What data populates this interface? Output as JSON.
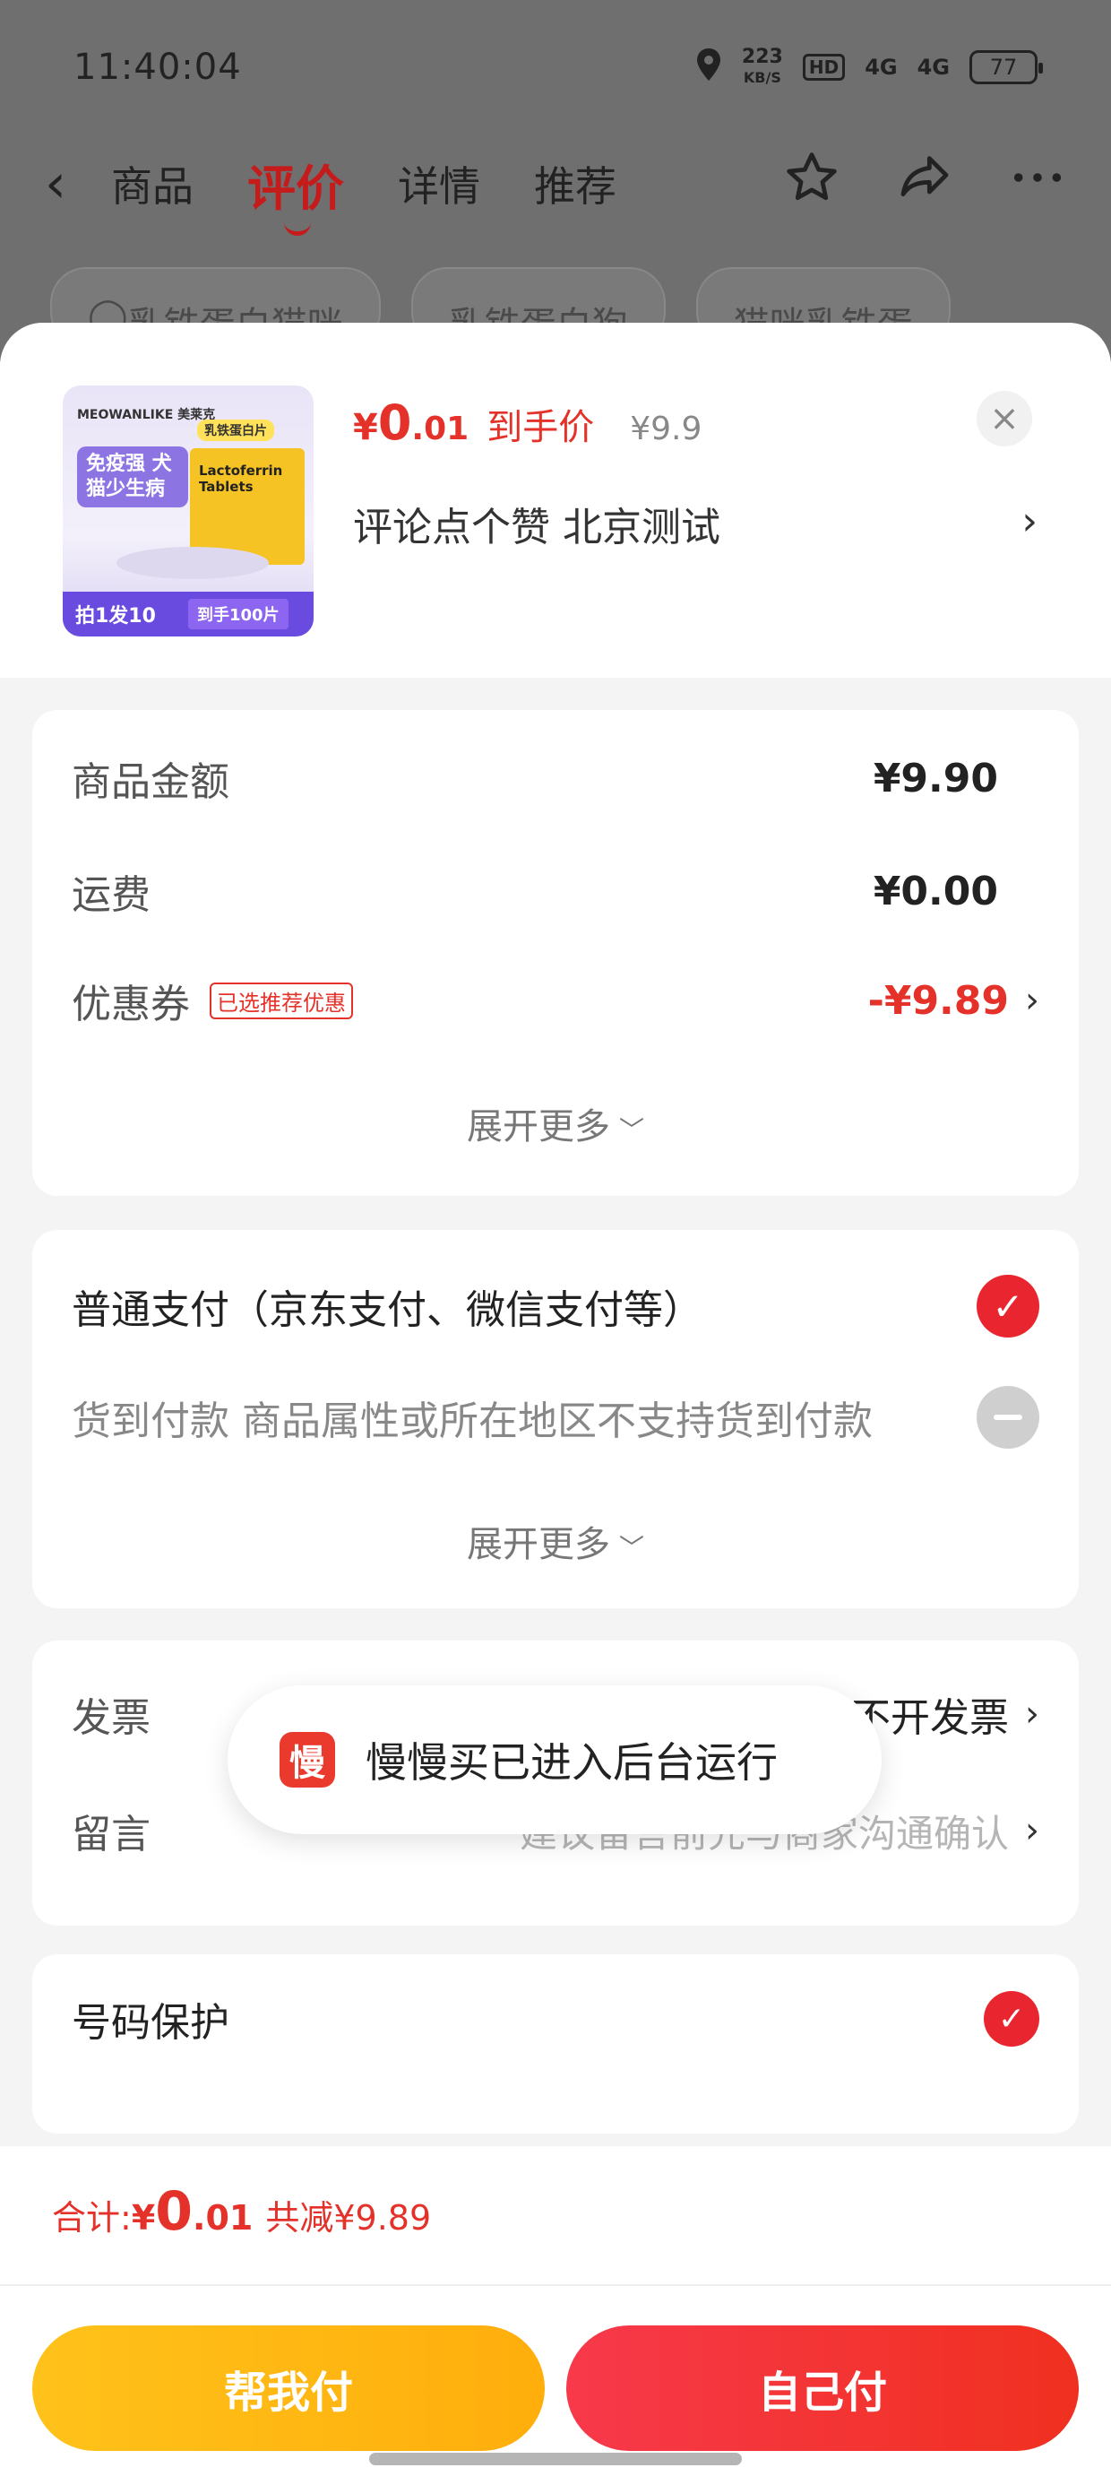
{
  "status_bar": {
    "time": "11:40:04",
    "net_speed": "223",
    "net_unit": "KB/S",
    "hd": "HD",
    "signal1": "4G",
    "signal2": "4G",
    "battery": "77"
  },
  "nav": {
    "tabs": [
      "商品",
      "评价",
      "详情",
      "推荐"
    ],
    "active_tab": "评价"
  },
  "search_chips": [
    "乳铁蛋白猫咪",
    "乳铁蛋白狗",
    "猫咪乳铁蛋"
  ],
  "product": {
    "image_brand": "MEOWANLIKE 美莱克",
    "image_tag": "乳铁蛋白片",
    "image_slogan": "免疫强 犬猫少生病",
    "image_box_text": "Lactoferrin Tablets",
    "image_promo_a": "拍1发10",
    "image_promo_b": "到手100片",
    "price_currency": "¥",
    "price_int": "0",
    "price_dec": ".01",
    "price_label": "到手价",
    "original_price": "¥9.9",
    "title": "评论点个赞  北京测试"
  },
  "amounts": {
    "goods_label": "商品金额",
    "goods_value": "¥9.90",
    "shipping_label": "运费",
    "shipping_value": "¥0.00",
    "coupon_label": "优惠券",
    "coupon_badge": "已选推荐优惠",
    "coupon_value": "-¥9.89",
    "expand": "展开更多"
  },
  "payment": {
    "normal": "普通支付（京东支付、微信支付等）",
    "cod": "货到付款  商品属性或所在地区不支持货到付款",
    "expand": "展开更多"
  },
  "extras": {
    "invoice_label": "发票",
    "invoice_value": "不开发票",
    "message_label": "留言",
    "message_placeholder": "建议留言前先与商家沟通确认"
  },
  "privacy": {
    "label": "号码保护"
  },
  "toast": {
    "logo": "慢",
    "message": "慢慢买已进入后台运行"
  },
  "bottom": {
    "total_label": "合计:",
    "total_currency": "¥",
    "total_int": "0",
    "total_dec": ".01",
    "discount": "共减¥9.89",
    "help_pay": "帮我付",
    "self_pay": "自己付"
  },
  "colors": {
    "accent": "#e4322a",
    "help_button": "#ffb812",
    "self_button": "#f2352c"
  }
}
